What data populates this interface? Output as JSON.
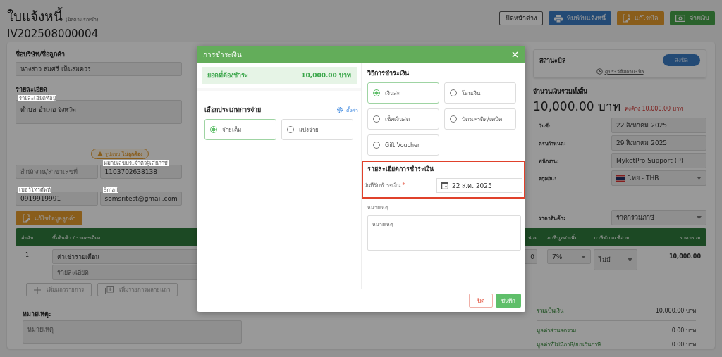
{
  "page": {
    "title": "ใบแจ้งหนี้",
    "subtitle": "(บิลค่าแรกเข้า)",
    "document_number": "IV202508000004"
  },
  "header_buttons": [
    {
      "kind": "outline",
      "label": "ปิดหน้าต่าง"
    },
    {
      "kind": "print",
      "label": "พิมพ์ใบแจ้งหนี้"
    },
    {
      "kind": "edit",
      "label": "แก้ไขบิล"
    },
    {
      "kind": "pay",
      "label": "จ่ายเงิน"
    }
  ],
  "customer": {
    "name_label": "ชื่อบริษัท/ชื่อลูกค้า",
    "name": "นางสาว สมศรี เห็นสมควร",
    "details_label": "รายละเอียด",
    "address_label": "รายละเอียดที่อยู่",
    "address": "ตำบล อำเภอ จังหวัด",
    "format_warning": "รูปแบบ **ไม่ถูกต้อง**",
    "branch_placeholder": "สำนักงาน/สาขาเลขที่",
    "tax_id_label": "หมายเลขประจำตัวผู้เสียภาษี",
    "tax_id": "1103702638138",
    "phone_label": "เบอร์โทรศัพท์",
    "phone": "0919919991",
    "email_label": "Email",
    "email": "somsritest@gmail.com",
    "edit_button": "แก้ไขข้อมูลลูกค้า"
  },
  "bill_status": {
    "label": "สถานะบิล",
    "button": "ส่งบิล",
    "history_link": "ดูประวัติสถานะบิล"
  },
  "total": {
    "label": "จำนวนเงินรวมทั้งสิ้น",
    "amount": "10,000.00 บาท",
    "outstanding": "คงค้าง 10,000.00 บาท"
  },
  "info_fields": [
    {
      "kind": "text",
      "label": "วันที่:",
      "value": "22 สิงหาคม 2025"
    },
    {
      "kind": "text",
      "label": "ครบกำหนด:",
      "value": "29 สิงหาคม 2025"
    },
    {
      "kind": "text",
      "label": "พนักงาน:",
      "value": "MyketPro Support (P)"
    },
    {
      "kind": "currency",
      "label": "สกุลเงิน:",
      "value": "ไทย - THB"
    }
  ],
  "price_type": {
    "label": "ราคาสินค้า:",
    "value": "ราคารวมภาษี"
  },
  "table": {
    "columns": [
      "ลำดับ",
      "ชื่อสินค้า / รายละเอียด",
      "น่วย",
      "ภาษีมูลค่าเพิ่ม",
      "ภาษีหัก ณ ที่จ่าย",
      "ราคารวม"
    ],
    "rows": [
      {
        "index": "1",
        "name": "ค่าเช่ารายเดือน",
        "detail_placeholder": "รายละเอียด",
        "unit": "0",
        "vat": "7%",
        "withholding": "ไม่มี",
        "total": "10,000.00"
      }
    ]
  },
  "add_buttons": [
    {
      "kind": "plus",
      "label": "เพิ่มแถวรายการ"
    },
    {
      "kind": "multi",
      "label": "เพิ่มรายการหลายแถว"
    }
  ],
  "remark": {
    "label": "หมายเหตุ:",
    "placeholder": "หมายเหตุ"
  },
  "totals": [
    {
      "label": "รวมเป็นเงิน",
      "value": "10,000.00 บาท"
    },
    {
      "label": "มูลค่าส่วนลดรวม",
      "value": "0.00 บาท"
    },
    {
      "label": "มูลค่าที่ไม่มีภาษี/ยกเว้นภาษี",
      "value": "0.00 บาท"
    }
  ],
  "modal": {
    "title": "การชำระเงิน",
    "due_label": "ยอดที่ต้องชำระ",
    "due_amount": "10,000.00 บาท",
    "type_label": "เลือกประเภทการจ่าย",
    "settings_link": "ตั้งค่า",
    "pay_types": [
      {
        "label": "จ่ายเต็ม",
        "selected": true
      },
      {
        "label": "แบ่งจ่าย",
        "selected": false
      }
    ],
    "method_label": "วิธีการชำระเงิน",
    "methods": [
      {
        "label": "เงินสด",
        "selected": true
      },
      {
        "label": "โอนเงิน",
        "selected": false
      },
      {
        "label": "เช็คเงินสด",
        "selected": false
      },
      {
        "label": "บัตรเครดิต/เดบิต",
        "selected": false
      },
      {
        "label": "Gift Voucher",
        "selected": false
      }
    ],
    "details_label": "รายละเอียดการชำระเงิน",
    "date_label": "วันที่รับชำระเงิน",
    "required_mark": "*",
    "date_value": "22 ส.ค. 2025",
    "note_label": "หมายเหตุ",
    "note_placeholder": "หมายเหตุ",
    "buttons": [
      {
        "kind": "cancel",
        "label": "ปิด"
      },
      {
        "kind": "save",
        "label": "บันทึก"
      }
    ]
  }
}
